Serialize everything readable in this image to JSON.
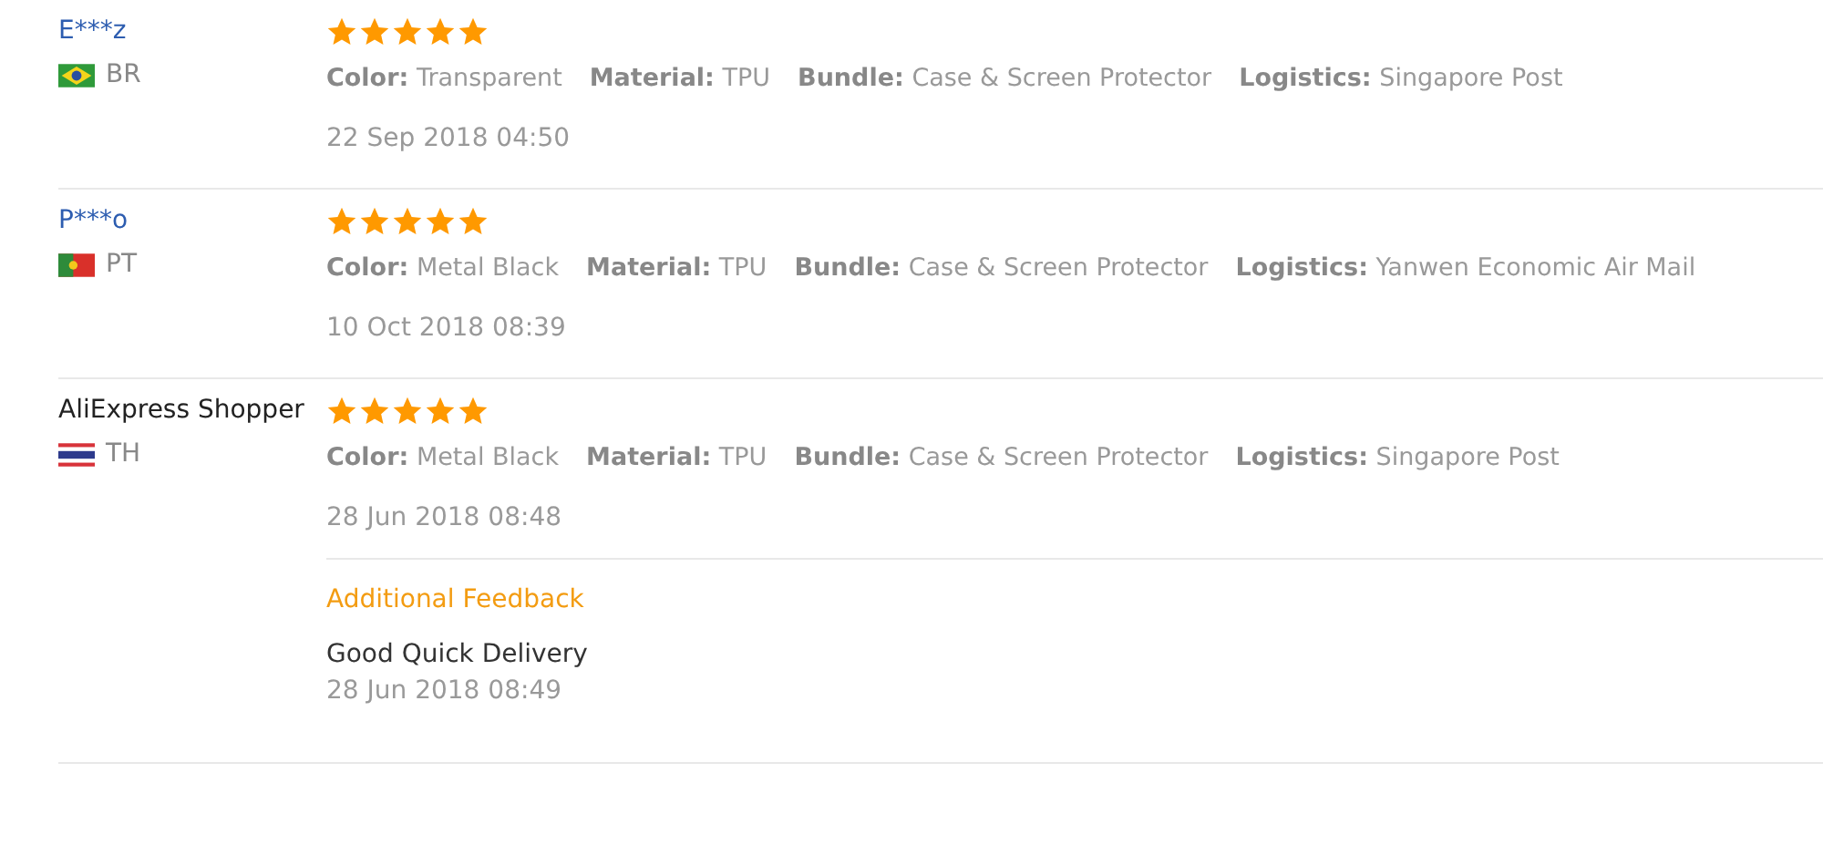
{
  "reviews": [
    {
      "name": "E***z",
      "linked": true,
      "flag": {
        "kind": "brazil"
      },
      "country": "BR",
      "stars": 5,
      "attributes": [
        {
          "label": "Color:",
          "value": "Transparent"
        },
        {
          "label": "Material:",
          "value": "TPU"
        },
        {
          "label": "Bundle:",
          "value": "Case & Screen Protector"
        },
        {
          "label": "Logistics:",
          "value": "Singapore Post"
        }
      ],
      "date": "22 Sep 2018 04:50"
    },
    {
      "name": "P***o",
      "linked": true,
      "flag": {
        "kind": "portugal"
      },
      "country": "PT",
      "stars": 5,
      "attributes": [
        {
          "label": "Color:",
          "value": "Metal Black"
        },
        {
          "label": "Material:",
          "value": "TPU"
        },
        {
          "label": "Bundle:",
          "value": "Case & Screen Protector"
        },
        {
          "label": "Logistics:",
          "value": "Yanwen Economic Air Mail"
        }
      ],
      "date": "10 Oct 2018 08:39"
    },
    {
      "name": "AliExpress Shopper",
      "linked": false,
      "flag": {
        "kind": "thailand"
      },
      "country": "TH",
      "stars": 5,
      "attributes": [
        {
          "label": "Color:",
          "value": "Metal Black"
        },
        {
          "label": "Material:",
          "value": "TPU"
        },
        {
          "label": "Bundle:",
          "value": "Case & Screen Protector"
        },
        {
          "label": "Logistics:",
          "value": "Singapore Post"
        }
      ],
      "date": "28 Jun 2018 08:48",
      "feedback": {
        "title": "Additional Feedback",
        "text": "Good Quick Delivery",
        "date": "28 Jun 2018 08:49"
      }
    }
  ]
}
